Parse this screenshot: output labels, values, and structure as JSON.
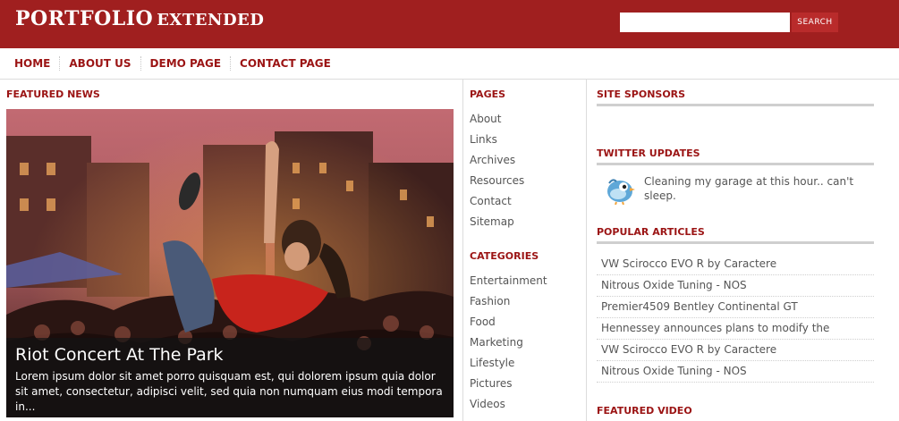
{
  "header": {
    "logo_main": "PORTFOLIO",
    "logo_sub": "EXTENDED",
    "search_placeholder": "",
    "search_button": "SEARCH",
    "color": "#a01f1f"
  },
  "nav": {
    "items": [
      "HOME",
      "ABOUT US",
      "DEMO PAGE",
      "CONTACT PAGE"
    ]
  },
  "featured": {
    "section_title": "FEATURED NEWS",
    "caption_title": "Riot Concert At The Park",
    "caption_text": "Lorem ipsum dolor sit amet porro quisquam est, qui dolorem ipsum quia dolor sit amet, consectetur, adipisci velit, sed quia non numquam eius modi tempora in..."
  },
  "pages": {
    "title": "PAGES",
    "items": [
      "About",
      "Links",
      "Archives",
      "Resources",
      "Contact",
      "Sitemap"
    ]
  },
  "categories": {
    "title": "CATEGORIES",
    "items": [
      "Entertainment",
      "Fashion",
      "Food",
      "Marketing",
      "Lifestyle",
      "Pictures",
      "Videos"
    ]
  },
  "sponsors": {
    "title": "SITE SPONSORS"
  },
  "twitter": {
    "title": "TWITTER UPDATES",
    "text": "Cleaning my garage at this hour.. can't sleep.",
    "icon": "bird-icon"
  },
  "popular": {
    "title": "POPULAR ARTICLES",
    "items": [
      "VW Scirocco EVO R by Caractere",
      "Nitrous Oxide Tuning - NOS",
      "Premier4509 Bentley Continental GT",
      "Hennessey announces plans to modify the",
      "VW Scirocco EVO R by Caractere",
      "Nitrous Oxide Tuning - NOS"
    ]
  },
  "video": {
    "title": "FEATURED VIDEO"
  }
}
